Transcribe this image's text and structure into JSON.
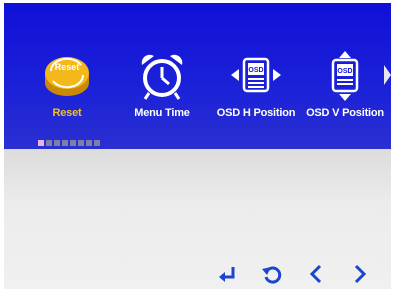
{
  "menu": {
    "items": [
      {
        "label": "Reset",
        "icon": "reset-icon",
        "icon_text": "Reset",
        "selected": true
      },
      {
        "label": "Menu Time",
        "icon": "alarm-clock-icon",
        "selected": false
      },
      {
        "label": "OSD H Position",
        "icon": "osd-h-position-icon",
        "icon_text": "OSD",
        "selected": false
      },
      {
        "label": "OSD V Position",
        "icon": "osd-v-position-icon",
        "icon_text": "OSD",
        "selected": false
      }
    ],
    "page_current": 1,
    "page_total": 8
  },
  "nav": {
    "buttons": [
      {
        "name": "enter-icon"
      },
      {
        "name": "return-icon"
      },
      {
        "name": "left-icon"
      },
      {
        "name": "right-icon"
      }
    ]
  },
  "colors": {
    "bar_blue": "#1414d6",
    "selected_label": "#f5c21a",
    "icon_yellow": "#f3b81a",
    "nav_blue": "#1a45d0",
    "screen_grey": "#e8e8e8"
  }
}
